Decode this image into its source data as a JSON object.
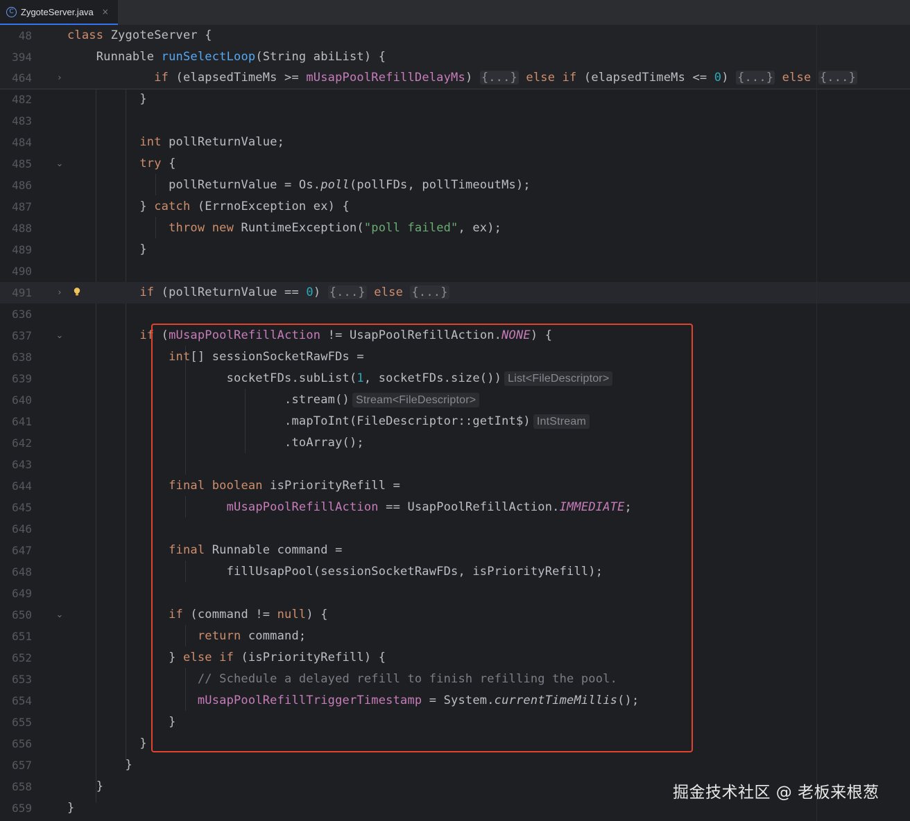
{
  "tab": {
    "icon": "java-class-icon",
    "title": "ZygoteServer.java",
    "close": "×"
  },
  "lines": {
    "l48": {
      "num": "48",
      "t1": "class ",
      "t2": "ZygoteServer {"
    },
    "l394": {
      "num": "394",
      "t1": "    Runnable ",
      "t2": "runSelectLoop",
      "t3": "(String abiList) {"
    },
    "l464": {
      "num": "464",
      "t1": "            ",
      "t2": "if",
      "t3": " (elapsedTimeMs >= ",
      "t4": "mUsapPoolRefillDelayMs",
      "t5": ") ",
      "t6": "{...}",
      "t7": " else if",
      "t8": " (elapsedTimeMs <= ",
      "t9": "0",
      "t10": ") ",
      "t11": "{...}",
      "t12": " else ",
      "t13": "{...}"
    },
    "l482": {
      "num": "482",
      "t1": "          }"
    },
    "l483": {
      "num": "483"
    },
    "l484": {
      "num": "484",
      "t1": "          ",
      "t2": "int",
      "t3": " pollReturnValue;"
    },
    "l485": {
      "num": "485",
      "t1": "          ",
      "t2": "try",
      "t3": " {"
    },
    "l486": {
      "num": "486",
      "t1": "              pollReturnValue = Os.",
      "t2": "poll",
      "t3": "(pollFDs, pollTimeoutMs);"
    },
    "l487": {
      "num": "487",
      "t1": "          } ",
      "t2": "catch",
      "t3": " (ErrnoException ex) {"
    },
    "l488": {
      "num": "488",
      "t1": "              ",
      "t2": "throw new",
      "t3": " RuntimeException(",
      "t4": "\"poll failed\"",
      "t5": ", ex);"
    },
    "l489": {
      "num": "489",
      "t1": "          }"
    },
    "l490": {
      "num": "490"
    },
    "l491": {
      "num": "491",
      "t1": "          ",
      "t2": "if",
      "t3": " (pollReturnValue == ",
      "t4": "0",
      "t5": ") ",
      "t6": "{...}",
      "t7": " else ",
      "t8": "{...}"
    },
    "l636": {
      "num": "636"
    },
    "l637": {
      "num": "637",
      "t1": "          ",
      "t2": "if",
      "t3": " (",
      "t4": "mUsapPoolRefillAction",
      "t5": " != UsapPoolRefillAction.",
      "t6": "NONE",
      "t7": ") {"
    },
    "l638": {
      "num": "638",
      "t1": "              ",
      "t2": "int",
      "t3": "[] sessionSocketRawFDs ="
    },
    "l639": {
      "num": "639",
      "t1": "                      socketFDs.subList(",
      "t2": "1",
      "t3": ", socketFDs.size())",
      "hint": "List<FileDescriptor>"
    },
    "l640": {
      "num": "640",
      "t1": "                              .stream()",
      "hint": "Stream<FileDescriptor>"
    },
    "l641": {
      "num": "641",
      "t1": "                              .mapToInt(FileDescriptor::getInt$)",
      "hint": "IntStream"
    },
    "l642": {
      "num": "642",
      "t1": "                              .toArray();"
    },
    "l643": {
      "num": "643"
    },
    "l644": {
      "num": "644",
      "t1": "              ",
      "t2": "final boolean",
      "t3": " isPriorityRefill ="
    },
    "l645": {
      "num": "645",
      "t1": "                      ",
      "t2": "mUsapPoolRefillAction",
      "t3": " == UsapPoolRefillAction.",
      "t4": "IMMEDIATE",
      "t5": ";"
    },
    "l646": {
      "num": "646"
    },
    "l647": {
      "num": "647",
      "t1": "              ",
      "t2": "final",
      "t3": " Runnable command ="
    },
    "l648": {
      "num": "648",
      "t1": "                      fillUsapPool(sessionSocketRawFDs, isPriorityRefill);"
    },
    "l649": {
      "num": "649"
    },
    "l650": {
      "num": "650",
      "t1": "              ",
      "t2": "if",
      "t3": " (command != ",
      "t4": "null",
      "t5": ") {"
    },
    "l651": {
      "num": "651",
      "t1": "                  ",
      "t2": "return",
      "t3": " command;"
    },
    "l652": {
      "num": "652",
      "t1": "              } ",
      "t2": "else if",
      "t3": " (isPriorityRefill) {"
    },
    "l653": {
      "num": "653",
      "t1": "                  ",
      "t2": "// Schedule a delayed refill to finish refilling the pool."
    },
    "l654": {
      "num": "654",
      "t1": "                  ",
      "t2": "mUsapPoolRefillTriggerTimestamp",
      "t3": " = System.",
      "t4": "currentTimeMillis",
      "t5": "();"
    },
    "l655": {
      "num": "655",
      "t1": "              }"
    },
    "l656": {
      "num": "656",
      "t1": "          }"
    },
    "l657": {
      "num": "657",
      "t1": "        }"
    },
    "l658": {
      "num": "658",
      "t1": "    }"
    },
    "l659": {
      "num": "659",
      "t1": "}"
    }
  },
  "gutter": {
    "fold_collapsed": "›",
    "fold_expanded": "⌄",
    "bulb": "lightbulb-icon"
  },
  "watermark": "掘金技术社区 @ 老板来根葱",
  "colors": {
    "background": "#1e1f22",
    "keyword": "#cf8e6d",
    "field": "#c77dbb",
    "method": "#56a8f5",
    "number": "#2aacb8",
    "string": "#6aab73",
    "highlight_box": "#e0442f"
  }
}
